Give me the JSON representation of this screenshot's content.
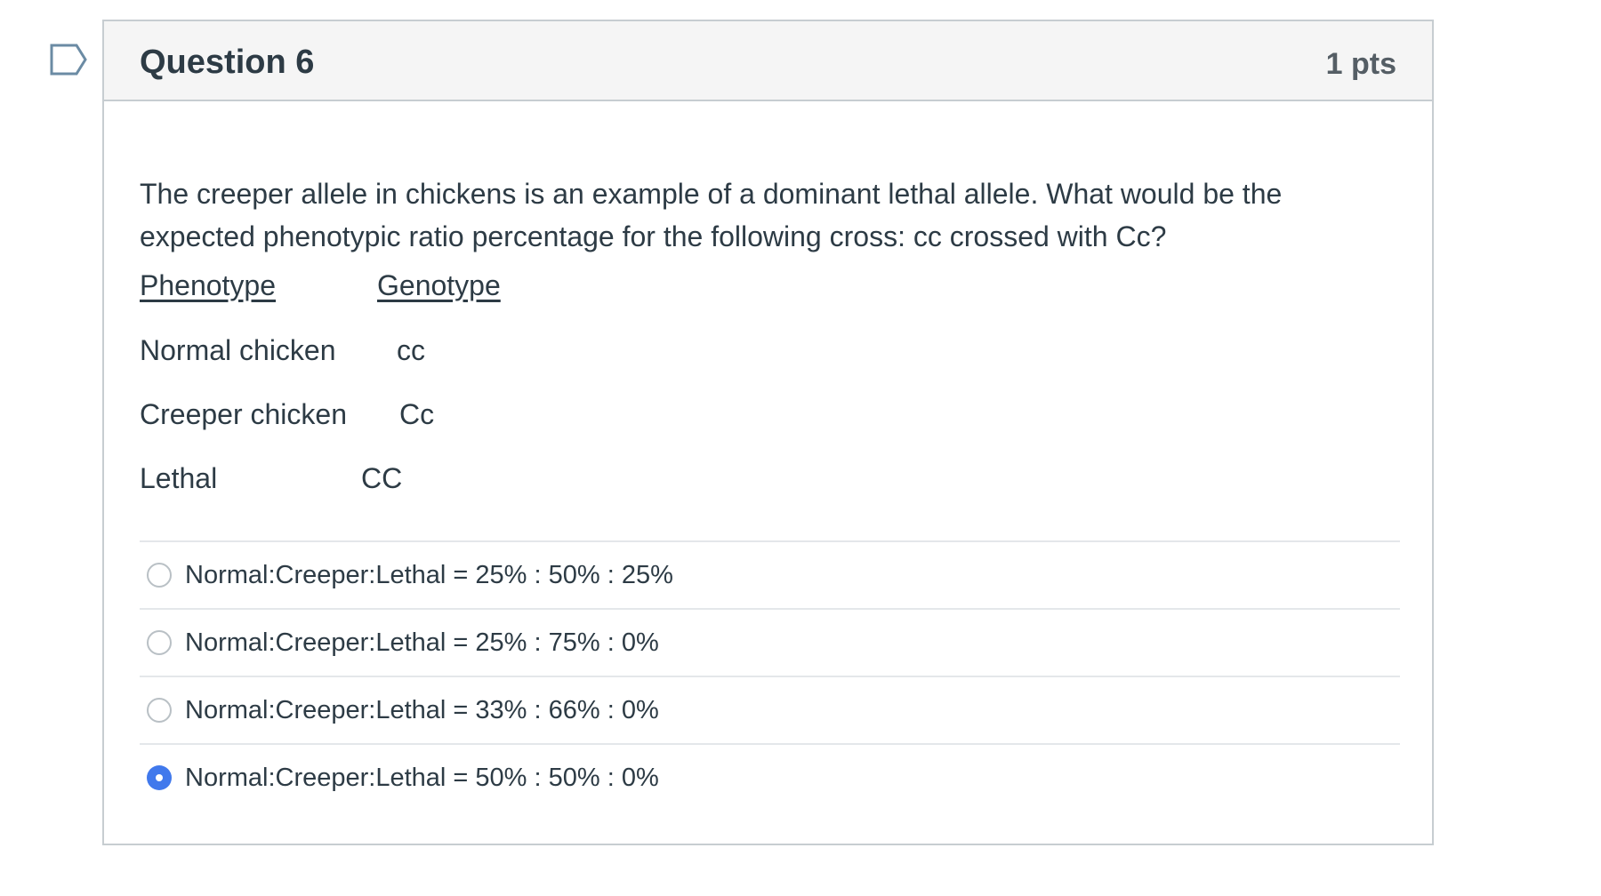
{
  "question": {
    "title": "Question 6",
    "points": "1 pts",
    "prompt": "The creeper allele in chickens is an example of a dominant lethal allele. What would be the expected phenotypic ratio percentage for the following cross: cc crossed with Cc?",
    "table": {
      "headers": [
        "Phenotype",
        "Genotype"
      ],
      "rows": [
        {
          "phenotype": "Normal chicken",
          "genotype": "cc"
        },
        {
          "phenotype": "Creeper chicken",
          "genotype": "Cc"
        },
        {
          "phenotype": "Lethal",
          "genotype": "CC"
        }
      ]
    },
    "answers": [
      {
        "label": "Normal:Creeper:Lethal = 25% : 50% : 25%",
        "selected": false
      },
      {
        "label": "Normal:Creeper:Lethal = 25% : 75% : 0%",
        "selected": false
      },
      {
        "label": "Normal:Creeper:Lethal = 33% : 66% : 0%",
        "selected": false
      },
      {
        "label": "Normal:Creeper:Lethal = 50% : 50% : 0%",
        "selected": true
      }
    ]
  },
  "colors": {
    "flag": "#6b8ba4",
    "radio_selected": "#4179ec",
    "header_bg": "#f5f5f5",
    "border": "#c7cdd1"
  },
  "icons": {
    "flag": "bookmark-flag-icon"
  }
}
